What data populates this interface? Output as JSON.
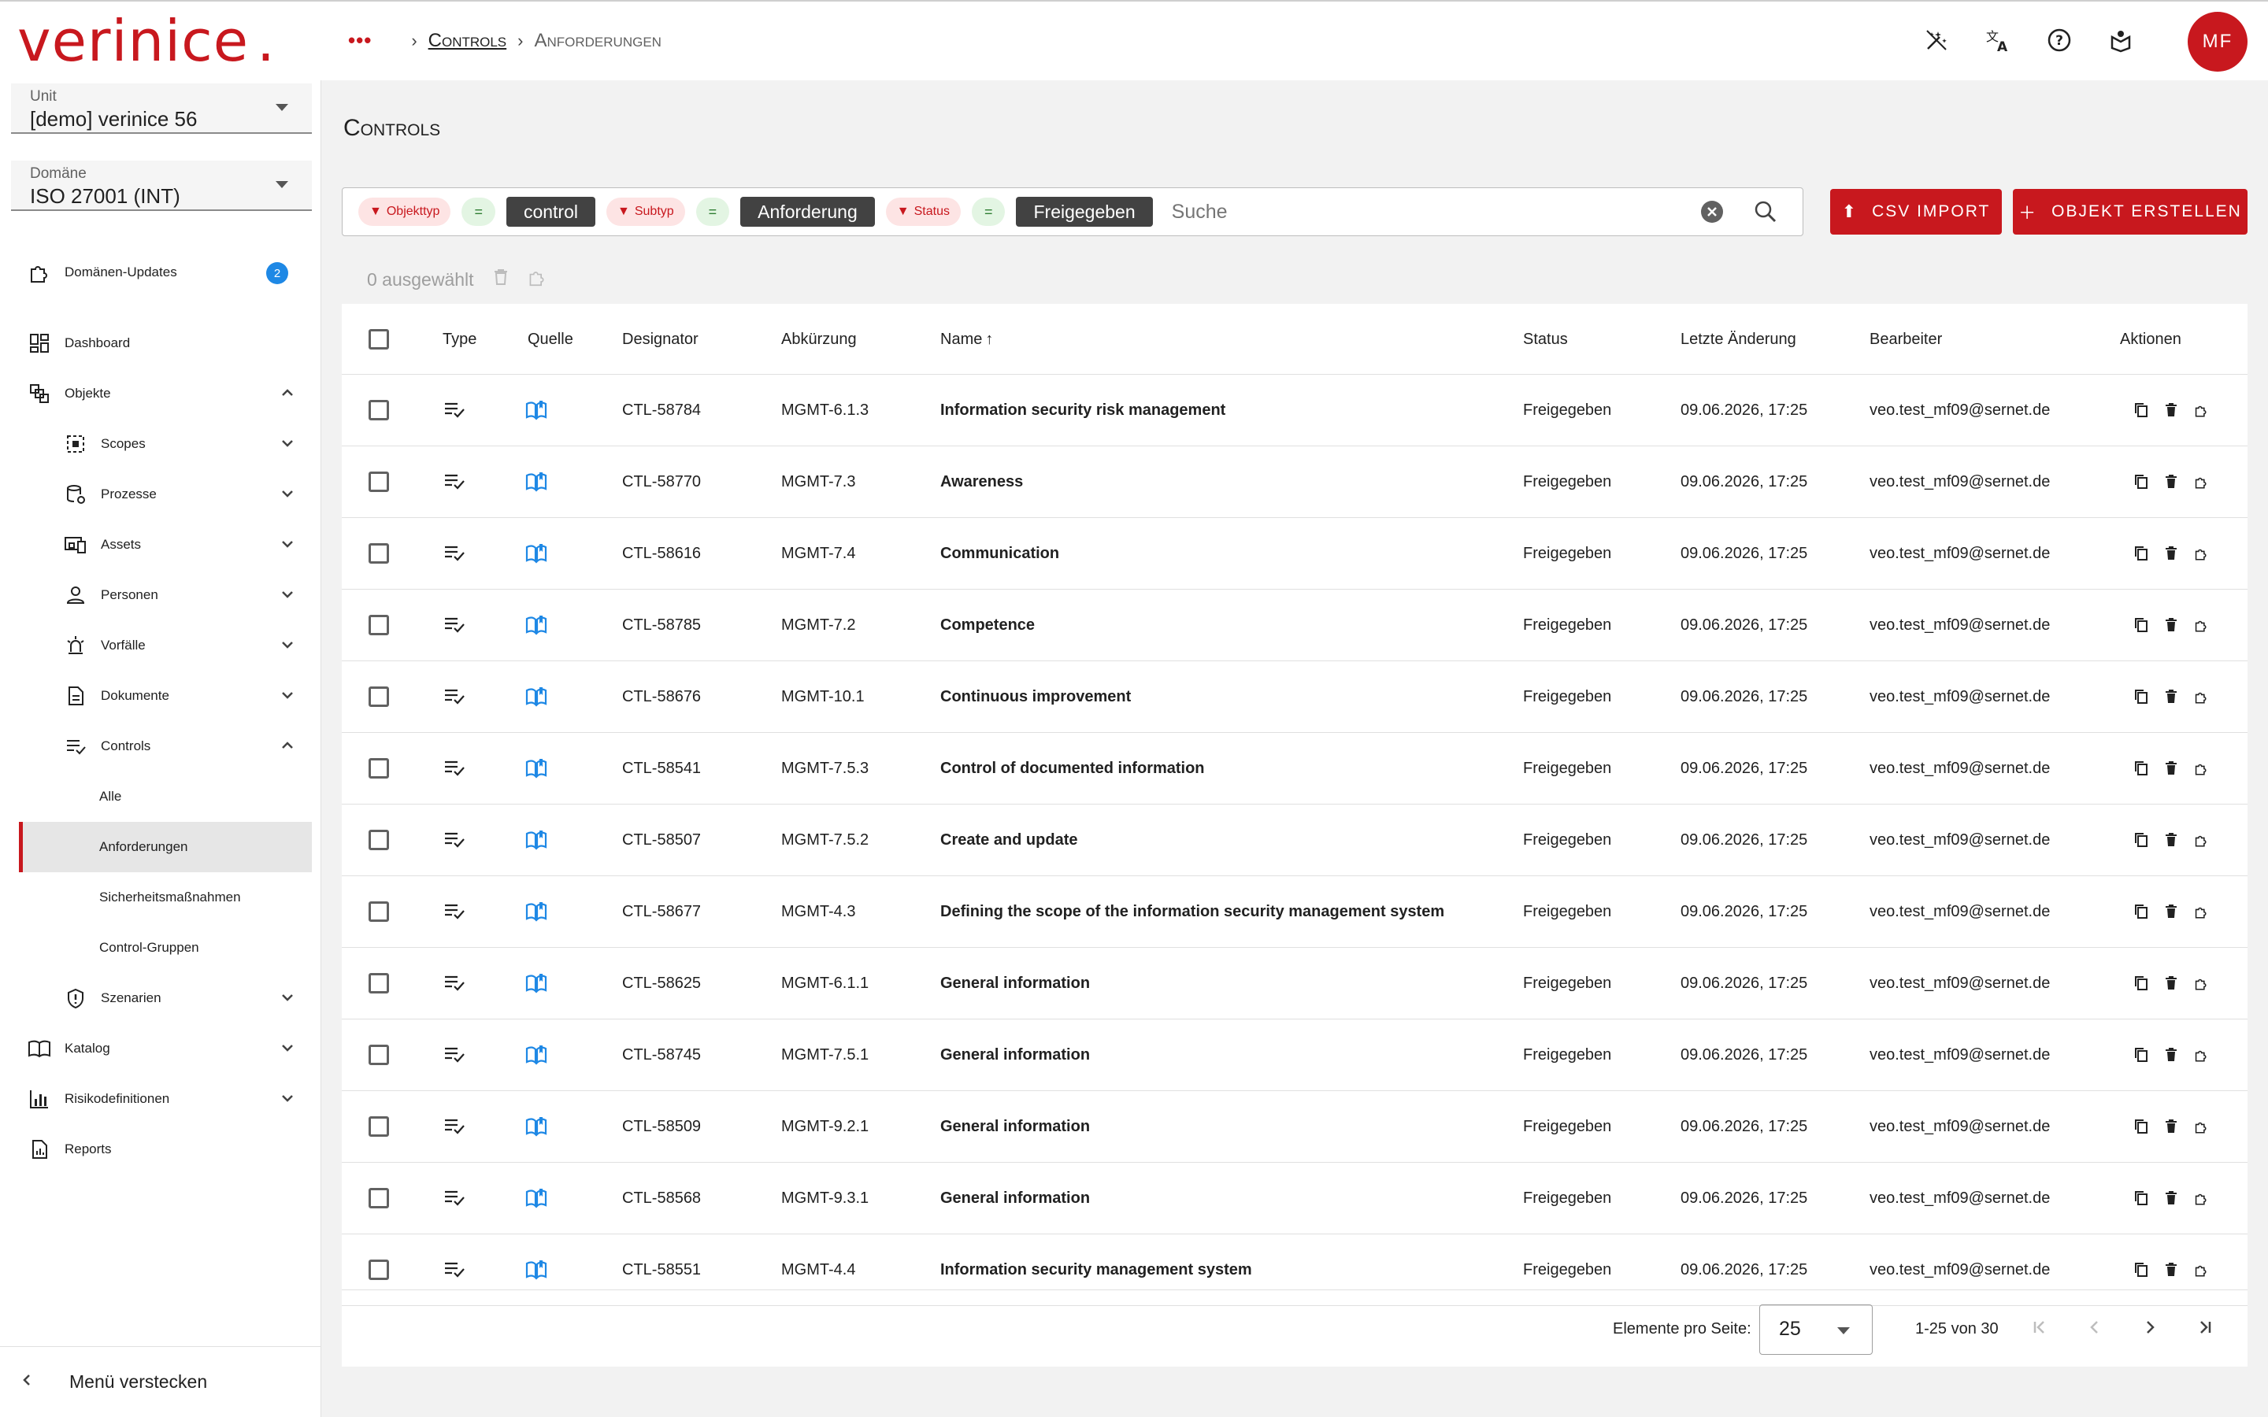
{
  "brand": {
    "logo": "verinice",
    "logo_dot": ".",
    "accent": "#c8181e"
  },
  "breadcrumb": {
    "more": "•••",
    "items": [
      "Controls",
      "Anforderungen"
    ]
  },
  "user": {
    "initials": "MF"
  },
  "top_icons": [
    "magic-wand-icon",
    "translate-icon",
    "help-icon",
    "tutorial-icon"
  ],
  "sidebar": {
    "unit": {
      "label": "Unit",
      "value": "[demo] verinice 56"
    },
    "domain": {
      "label": "Domäne",
      "value": "ISO 27001 (INT)"
    },
    "items": [
      {
        "label": "Domänen-Updates",
        "badge": "2"
      },
      {
        "label": "Dashboard"
      },
      {
        "label": "Objekte"
      },
      {
        "label": "Scopes"
      },
      {
        "label": "Prozesse"
      },
      {
        "label": "Assets"
      },
      {
        "label": "Personen"
      },
      {
        "label": "Vorfälle"
      },
      {
        "label": "Dokumente"
      },
      {
        "label": "Controls"
      },
      {
        "label": "Alle"
      },
      {
        "label": "Anforderungen"
      },
      {
        "label": "Sicherheitsmaßnahmen"
      },
      {
        "label": "Control-Gruppen"
      },
      {
        "label": "Szenarien"
      },
      {
        "label": "Katalog"
      },
      {
        "label": "Risikodefinitionen"
      },
      {
        "label": "Reports"
      }
    ],
    "hide_menu": "Menü verstecken"
  },
  "page": {
    "title": "Controls"
  },
  "filters": [
    {
      "field": "Objekttyp",
      "op": "=",
      "value": "control"
    },
    {
      "field": "Subtyp",
      "op": "=",
      "value": "Anforderung"
    },
    {
      "field": "Status",
      "op": "=",
      "value": "Freigegeben"
    }
  ],
  "search": {
    "placeholder": "Suche"
  },
  "buttons": {
    "csv_import": "CSV IMPORT",
    "create": "OBJEKT ERSTELLEN"
  },
  "selection": {
    "text": "0 ausgewählt"
  },
  "table": {
    "columns": [
      "Type",
      "Quelle",
      "Designator",
      "Abkürzung",
      "Name",
      "Status",
      "Letzte Änderung",
      "Bearbeiter",
      "Aktionen"
    ],
    "rows": [
      {
        "designator": "CTL-58784",
        "abbr": "MGMT-6.1.3",
        "name": "Information security risk management",
        "status": "Freigegeben",
        "changed": "09.06.2026, 17:25",
        "editor": "veo.test_mf09@sernet.de"
      },
      {
        "designator": "CTL-58770",
        "abbr": "MGMT-7.3",
        "name": "Awareness",
        "status": "Freigegeben",
        "changed": "09.06.2026, 17:25",
        "editor": "veo.test_mf09@sernet.de"
      },
      {
        "designator": "CTL-58616",
        "abbr": "MGMT-7.4",
        "name": "Communication",
        "status": "Freigegeben",
        "changed": "09.06.2026, 17:25",
        "editor": "veo.test_mf09@sernet.de"
      },
      {
        "designator": "CTL-58785",
        "abbr": "MGMT-7.2",
        "name": "Competence",
        "status": "Freigegeben",
        "changed": "09.06.2026, 17:25",
        "editor": "veo.test_mf09@sernet.de"
      },
      {
        "designator": "CTL-58676",
        "abbr": "MGMT-10.1",
        "name": "Continuous improvement",
        "status": "Freigegeben",
        "changed": "09.06.2026, 17:25",
        "editor": "veo.test_mf09@sernet.de"
      },
      {
        "designator": "CTL-58541",
        "abbr": "MGMT-7.5.3",
        "name": "Control of documented information",
        "status": "Freigegeben",
        "changed": "09.06.2026, 17:25",
        "editor": "veo.test_mf09@sernet.de"
      },
      {
        "designator": "CTL-58507",
        "abbr": "MGMT-7.5.2",
        "name": "Create and update",
        "status": "Freigegeben",
        "changed": "09.06.2026, 17:25",
        "editor": "veo.test_mf09@sernet.de"
      },
      {
        "designator": "CTL-58677",
        "abbr": "MGMT-4.3",
        "name": "Defining the scope of the information security management system",
        "status": "Freigegeben",
        "changed": "09.06.2026, 17:25",
        "editor": "veo.test_mf09@sernet.de"
      },
      {
        "designator": "CTL-58625",
        "abbr": "MGMT-6.1.1",
        "name": "General information",
        "status": "Freigegeben",
        "changed": "09.06.2026, 17:25",
        "editor": "veo.test_mf09@sernet.de"
      },
      {
        "designator": "CTL-58745",
        "abbr": "MGMT-7.5.1",
        "name": "General information",
        "status": "Freigegeben",
        "changed": "09.06.2026, 17:25",
        "editor": "veo.test_mf09@sernet.de"
      },
      {
        "designator": "CTL-58509",
        "abbr": "MGMT-9.2.1",
        "name": "General information",
        "status": "Freigegeben",
        "changed": "09.06.2026, 17:25",
        "editor": "veo.test_mf09@sernet.de"
      },
      {
        "designator": "CTL-58568",
        "abbr": "MGMT-9.3.1",
        "name": "General information",
        "status": "Freigegeben",
        "changed": "09.06.2026, 17:25",
        "editor": "veo.test_mf09@sernet.de"
      },
      {
        "designator": "CTL-58551",
        "abbr": "MGMT-4.4",
        "name": "Information security management system",
        "status": "Freigegeben",
        "changed": "09.06.2026, 17:25",
        "editor": "veo.test_mf09@sernet.de"
      }
    ]
  },
  "pagination": {
    "per_page_label": "Elemente pro Seite:",
    "per_page": "25",
    "range": "1-25 von 30"
  }
}
